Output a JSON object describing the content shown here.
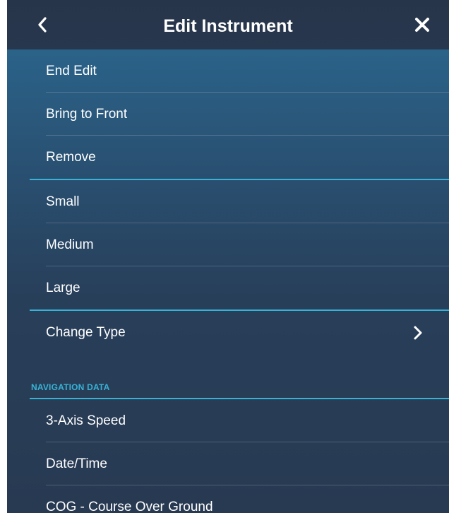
{
  "header": {
    "title": "Edit Instrument",
    "back_icon": "chevron-left-icon",
    "close_icon": "close-icon"
  },
  "menu": {
    "end_edit": "End Edit",
    "bring_to_front": "Bring to Front",
    "remove": "Remove",
    "small": "Small",
    "medium": "Medium",
    "large": "Large",
    "change_type": "Change Type"
  },
  "section": {
    "title": "NAVIGATION DATA",
    "items": [
      "3-Axis Speed",
      "Date/Time",
      "COG - Course Over Ground"
    ]
  },
  "colors": {
    "accent": "#37b3d6",
    "header_bg": "#27354a",
    "text": "#ffffff"
  }
}
